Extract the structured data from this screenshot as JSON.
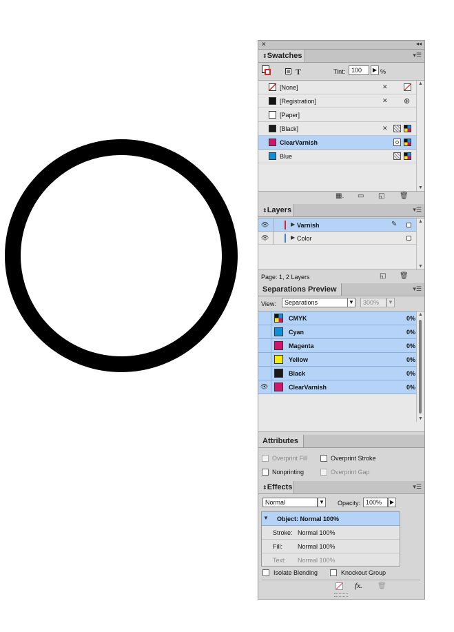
{
  "swatches": {
    "tab": "Swatches",
    "tint_label": "Tint:",
    "tint_value": "100",
    "tint_unit": "%",
    "items": [
      {
        "label": "[None]",
        "color": "#ffffff"
      },
      {
        "label": "[Registration]",
        "color": "#111111"
      },
      {
        "label": "[Paper]",
        "color": "#ffffff"
      },
      {
        "label": "[Black]",
        "color": "#1a1a1a"
      },
      {
        "label": "ClearVarnish",
        "color": "#d4136d"
      },
      {
        "label": "Blue",
        "color": "#0f8fd6"
      }
    ]
  },
  "layers": {
    "tab": "Layers",
    "items": [
      {
        "label": "Varnish",
        "color": "#e02020"
      },
      {
        "label": "Color",
        "color": "#3b7fe0"
      }
    ],
    "status": "Page: 1, 2 Layers"
  },
  "separations": {
    "tab": "Separations Preview",
    "view_label": "View:",
    "view_value": "Separations",
    "zoom_value": "300%",
    "items": [
      {
        "label": "CMYK",
        "value": "0%",
        "color": "cmyk"
      },
      {
        "label": "Cyan",
        "value": "0%",
        "color": "#0f8fd6"
      },
      {
        "label": "Magenta",
        "value": "0%",
        "color": "#d4136d"
      },
      {
        "label": "Yellow",
        "value": "0%",
        "color": "#f7ea10"
      },
      {
        "label": "Black",
        "value": "0%",
        "color": "#1a1a1a"
      },
      {
        "label": "ClearVarnish",
        "value": "0%",
        "color": "#d4136d"
      }
    ]
  },
  "attributes": {
    "tab": "Attributes",
    "overprint_fill": "Overprint Fill",
    "overprint_stroke": "Overprint Stroke",
    "nonprinting": "Nonprinting",
    "overprint_gap": "Overprint Gap"
  },
  "effects": {
    "tab": "Effects",
    "mode": "Normal",
    "opacity_label": "Opacity:",
    "opacity_value": "100%",
    "object_label": "Object: Normal 100%",
    "stroke_label": "Stroke:",
    "stroke_value": "Normal 100%",
    "fill_label": "Fill:",
    "fill_value": "Normal 100%",
    "text_label": "Text:",
    "text_value": "Normal 100%",
    "isolate": "Isolate Blending",
    "knockout": "Knockout Group",
    "fx": "fx."
  },
  "colors": {
    "selection": "#b4d3f6",
    "panel": "#d6d6d6"
  }
}
